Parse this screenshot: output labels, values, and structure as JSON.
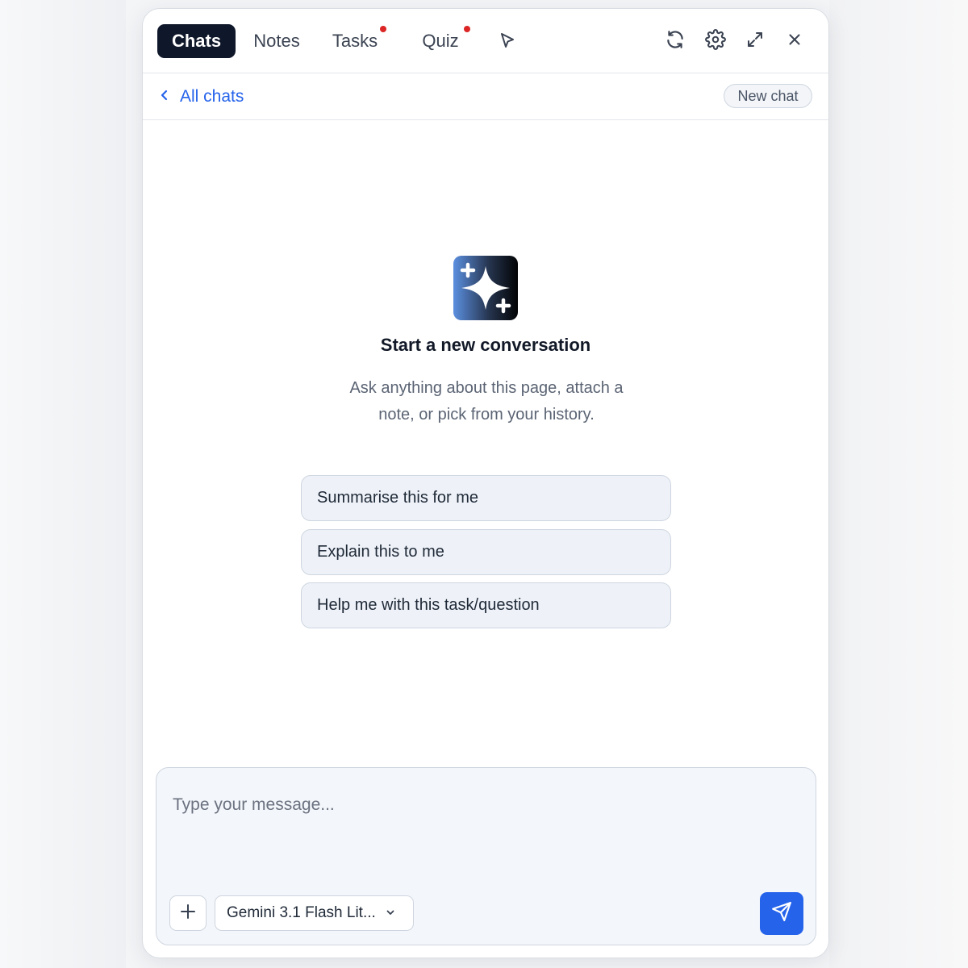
{
  "tabs": [
    {
      "label": "Chats",
      "active": true,
      "badge": false
    },
    {
      "label": "Notes",
      "active": false,
      "badge": false
    },
    {
      "label": "Tasks",
      "active": false,
      "badge": true
    },
    {
      "label": "Quiz",
      "active": false,
      "badge": true
    }
  ],
  "toolbar_icons": [
    "cursor-pointer-icon",
    "refresh-icon",
    "gear-icon",
    "expand-icon",
    "close-icon"
  ],
  "subbar": {
    "back_label": "All chats",
    "new_chat_label": "New chat"
  },
  "empty_state": {
    "icon": "sparkles-icon",
    "title": "Start a new conversation",
    "description": "Ask anything about this page, attach a note, or pick from your history."
  },
  "suggestions": [
    "Summarise this for me",
    "Explain this to me",
    "Help me with this task/question"
  ],
  "composer": {
    "placeholder": "Type your message...",
    "value": "",
    "model": "Gemini 3.1 Flash Lit..."
  },
  "colors": {
    "accent": "#2563eb",
    "active_tab_bg": "#0f172a",
    "badge": "#dc2626"
  }
}
